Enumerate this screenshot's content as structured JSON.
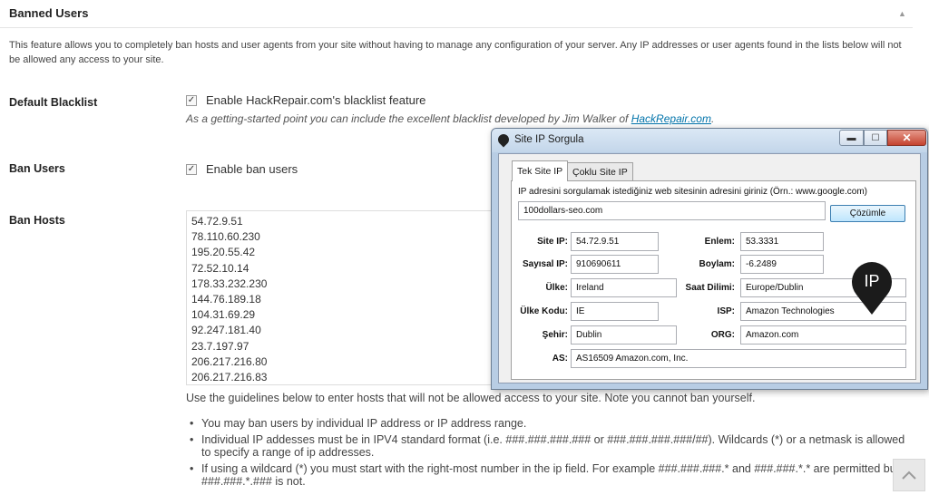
{
  "panel": {
    "title": "Banned Users",
    "intro": "This feature allows you to completely ban hosts and user agents from your site without having to manage any configuration of your server. Any IP addresses or user agents found in the lists below will not be allowed any access to your site."
  },
  "blacklist": {
    "label": "Default Blacklist",
    "checkbox_label": "Enable HackRepair.com's blacklist feature",
    "checked": true,
    "note_prefix": "As a getting-started point you can include the excellent blacklist developed by Jim Walker of ",
    "note_link": "HackRepair.com",
    "note_suffix": "."
  },
  "ban_users": {
    "label": "Ban Users",
    "checkbox_label": "Enable ban users",
    "checked": true
  },
  "ban_hosts": {
    "label": "Ban Hosts",
    "hosts": [
      "54.72.9.51",
      "78.110.60.230",
      "195.20.55.42",
      "72.52.10.14",
      "178.33.232.230",
      "144.76.189.18",
      "104.31.69.29",
      "92.247.181.40",
      "23.7.197.97",
      "206.217.216.80",
      "206.217.216.83"
    ],
    "guidelines": "Use the guidelines below to enter hosts that will not be allowed access to your site. Note you cannot ban yourself.",
    "bullets": [
      "You may ban users by individual IP address or IP address range.",
      "Individual IP addesses must be in IPV4 standard format (i.e. ###.###.###.### or ###.###.###.###/##). Wildcards (*) or a netmask is allowed to specify a range of ip addresses.",
      "If using a wildcard (*) you must start with the right-most number in the ip field. For example ###.###.###.* and ###.###.*.* are permitted but ###.###.*.### is not."
    ]
  },
  "dialog": {
    "title": "Site IP Sorgula",
    "tabs": [
      "Tek Site IP",
      "Çoklu Site IP"
    ],
    "active_tab": 0,
    "hint": "IP adresini sorgulamak istediğiniz web sitesinin adresini giriniz (Örn.: www.google.com)",
    "domain_value": "100dollars-seo.com",
    "solve_button": "Çözümle",
    "badge": "IP",
    "fields": {
      "site_ip": {
        "label": "Site IP:",
        "value": "54.72.9.51"
      },
      "numeric_ip": {
        "label": "Sayısal IP:",
        "value": "910690611"
      },
      "country": {
        "label": "Ülke:",
        "value": "Ireland"
      },
      "country_code": {
        "label": "Ülke Kodu:",
        "value": "IE"
      },
      "city": {
        "label": "Şehir:",
        "value": "Dublin"
      },
      "as": {
        "label": "AS:",
        "value": "AS16509 Amazon.com, Inc."
      },
      "latitude": {
        "label": "Enlem:",
        "value": "53.3331"
      },
      "longitude": {
        "label": "Boylam:",
        "value": "-6.2489"
      },
      "timezone": {
        "label": "Saat Dilimi:",
        "value": "Europe/Dublin"
      },
      "isp": {
        "label": "ISP:",
        "value": "Amazon Technologies"
      },
      "org": {
        "label": "ORG:",
        "value": "Amazon.com"
      }
    }
  },
  "icons": {
    "collapse": "triangle-up-icon",
    "scroll_top": "chevron-up-icon",
    "window": "map-pin-icon",
    "badge": "ip-pin-icon"
  }
}
